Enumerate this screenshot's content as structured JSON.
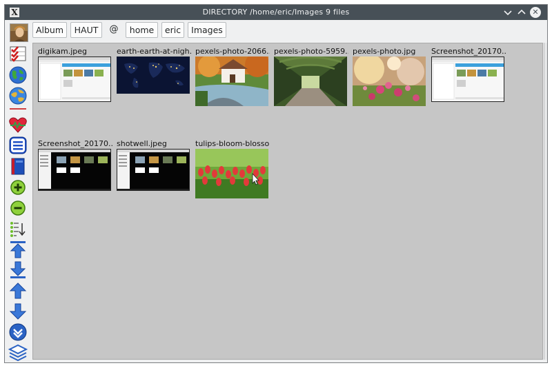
{
  "window": {
    "title": "DIRECTORY /home/eric/Images 9 files",
    "app_icon_glyph": "X",
    "minimize_icon": "chevron-down-icon",
    "maximize_icon": "chevron-up-icon",
    "close_icon": "close-icon",
    "close_glyph": "✕"
  },
  "toolbar": {
    "album_label": "Album",
    "haut_label": "HAUT",
    "separator": "@",
    "crumbs": [
      "home",
      "eric",
      "Images"
    ]
  },
  "tools": [
    "checklist-icon",
    "globe-icon",
    "globe-alt-icon",
    "heart-icon",
    "list-icon",
    "book-icon",
    "zoom-in-icon",
    "zoom-out-icon",
    "sort-icon",
    "go-top-icon",
    "go-bottom-icon",
    "arrow-up-icon",
    "arrow-down-icon",
    "chevron-down-circle-icon",
    "layers-icon"
  ],
  "files": [
    {
      "label": "digikam.jpeg",
      "kind": "screenshot-light"
    },
    {
      "label": "earth-earth-at-nigh...",
      "kind": "earth-night"
    },
    {
      "label": "pexels-photo-2066...",
      "kind": "garden"
    },
    {
      "label": "pexels-photo-5959...",
      "kind": "arbor"
    },
    {
      "label": "pexels-photo.jpg",
      "kind": "flowers"
    },
    {
      "label": "Screenshot_20170...",
      "kind": "screenshot-light"
    },
    {
      "label": "Screenshot_20170...",
      "kind": "screenshot-dark"
    },
    {
      "label": "shotwell.jpeg",
      "kind": "screenshot-dark"
    },
    {
      "label": "tulips-bloom-blosso...",
      "kind": "tulips"
    }
  ],
  "colors": {
    "titlebar": "#475057",
    "content_bg": "#c6c6c6",
    "icon_blue": "#2a62c4",
    "icon_green": "#6cbd2a"
  }
}
